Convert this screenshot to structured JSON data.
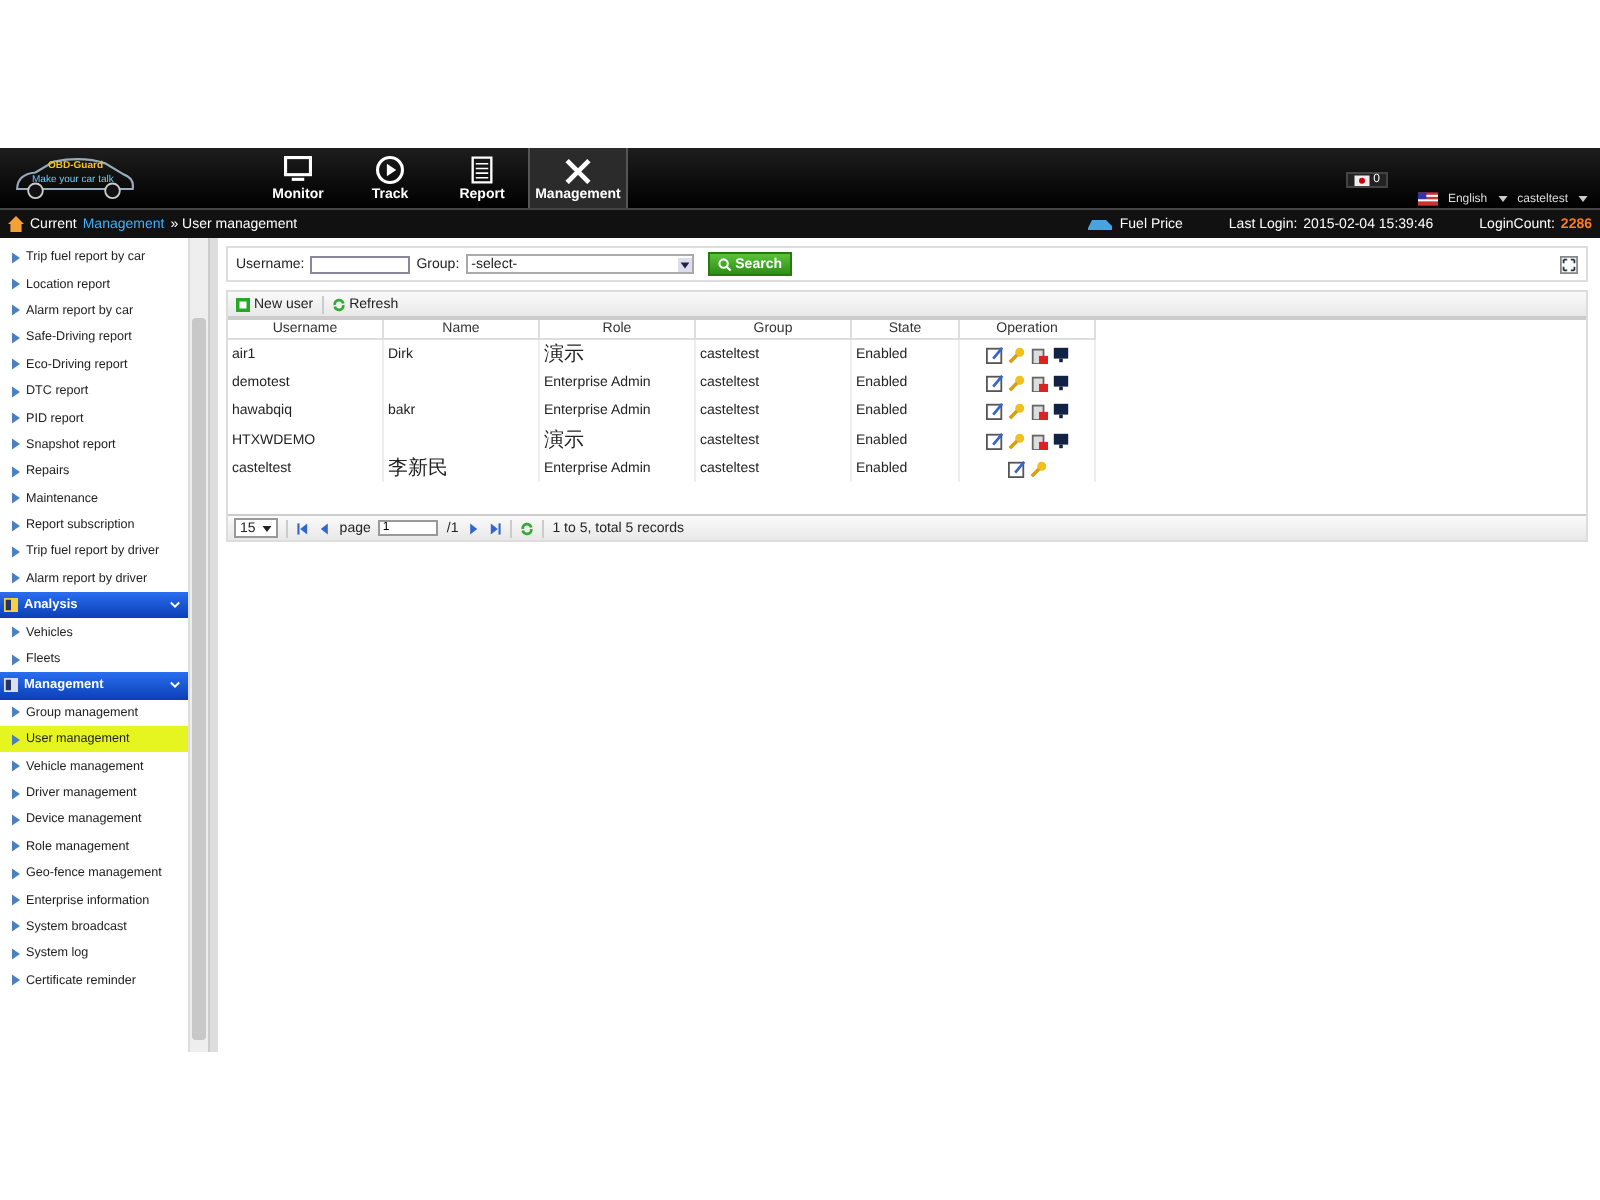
{
  "header": {
    "logo": "OBD-Guard",
    "logo_tagline": "Make your car talk",
    "nav": [
      {
        "kind": "monitor",
        "label": "Monitor",
        "selected": false
      },
      {
        "kind": "track",
        "label": "Track",
        "selected": false
      },
      {
        "kind": "report",
        "label": "Report",
        "selected": false
      },
      {
        "kind": "management",
        "label": "Management",
        "selected": true
      }
    ],
    "messages": "0",
    "language": "English",
    "user": "casteltest"
  },
  "breadcrumb": {
    "label": "Current",
    "link": "Management",
    "current": "» User management"
  },
  "status": {
    "fuel_price": "Fuel Price",
    "last_login_label": "Last Login:",
    "last_login": "2015-02-04 15:39:46",
    "login_count_label": "LoginCount:",
    "login_count": "2286"
  },
  "sidebar": {
    "sections": [
      {
        "items": [
          {
            "label": "Trip fuel report by car",
            "selected": false
          },
          {
            "label": "Location report",
            "selected": false
          },
          {
            "label": "Alarm report by car",
            "selected": false
          },
          {
            "label": "Safe-Driving report",
            "selected": false
          },
          {
            "label": "Eco-Driving report",
            "selected": false
          },
          {
            "label": "DTC report",
            "selected": false
          },
          {
            "label": "PID report",
            "selected": false
          },
          {
            "label": "Snapshot report",
            "selected": false
          },
          {
            "label": "Repairs",
            "selected": false
          },
          {
            "label": "Maintenance",
            "selected": false
          },
          {
            "label": "Report subscription",
            "selected": false
          },
          {
            "label": "Trip fuel report by driver",
            "selected": false
          },
          {
            "label": "Alarm report by driver",
            "selected": false
          }
        ]
      },
      {
        "title": "Analysis",
        "expanded": true,
        "items": [
          {
            "label": "Vehicles",
            "selected": false
          },
          {
            "label": "Fleets",
            "selected": false
          }
        ]
      },
      {
        "title": "Management",
        "expanded": true,
        "items": [
          {
            "label": "Group management",
            "selected": false
          },
          {
            "label": "User management",
            "selected": true
          },
          {
            "label": "Vehicle management",
            "selected": false
          },
          {
            "label": "Driver management",
            "selected": false
          },
          {
            "label": "Device management",
            "selected": false
          },
          {
            "label": "Role management",
            "selected": false
          },
          {
            "label": "Geo-fence management",
            "selected": false
          },
          {
            "label": "Enterprise information",
            "selected": false
          },
          {
            "label": "System broadcast",
            "selected": false
          },
          {
            "label": "System log",
            "selected": false
          },
          {
            "label": "Certificate reminder",
            "selected": false
          }
        ]
      }
    ]
  },
  "filter": {
    "username_label": "Username:",
    "group_label": "Group:",
    "group_value": "-select-",
    "search": "Search"
  },
  "toolbar": [
    "New user",
    "Refresh"
  ],
  "table": {
    "columns": [
      "Username",
      "Name",
      "Role",
      "Group",
      "State",
      "Operation"
    ],
    "rows": [
      {
        "cells": [
          "air1",
          "Dirk",
          "演示",
          "casteltest",
          "Enabled"
        ],
        "operations": [
          {
            "kind": "edit"
          },
          {
            "kind": "key"
          },
          {
            "kind": "delete"
          },
          {
            "kind": "monitor"
          }
        ]
      },
      {
        "cells": [
          "demotest",
          "",
          "Enterprise Admin",
          "casteltest",
          "Enabled"
        ],
        "operations": [
          {
            "kind": "edit"
          },
          {
            "kind": "key"
          },
          {
            "kind": "delete"
          },
          {
            "kind": "monitor"
          }
        ]
      },
      {
        "cells": [
          "hawabqiq",
          "bakr",
          "Enterprise Admin",
          "casteltest",
          "Enabled"
        ],
        "operations": [
          {
            "kind": "edit"
          },
          {
            "kind": "key"
          },
          {
            "kind": "delete"
          },
          {
            "kind": "monitor"
          }
        ]
      },
      {
        "cells": [
          "HTXWDEMO",
          "",
          "演示",
          "casteltest",
          "Enabled"
        ],
        "operations": [
          {
            "kind": "edit"
          },
          {
            "kind": "key"
          },
          {
            "kind": "delete"
          },
          {
            "kind": "monitor"
          }
        ]
      },
      {
        "cells": [
          "casteltest",
          "李新民",
          "Enterprise Admin",
          "casteltest",
          "Enabled"
        ],
        "operations": [
          {
            "kind": "edit"
          },
          {
            "kind": "key"
          }
        ]
      }
    ]
  },
  "pager": {
    "page_size": "15",
    "page_label": "page",
    "page": "1",
    "total_pages": "/1",
    "summary": "1 to 5, total 5 records"
  }
}
